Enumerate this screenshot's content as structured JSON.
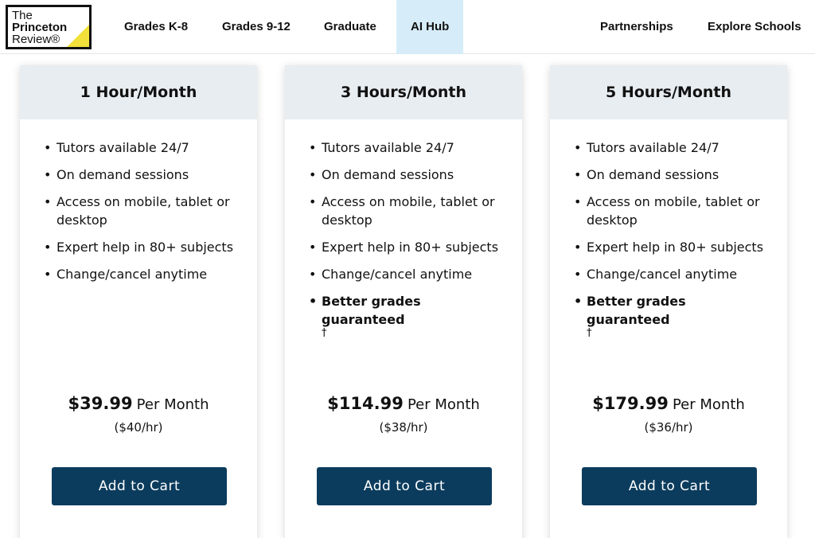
{
  "brand": {
    "line1": "The",
    "line2": "Princeton",
    "line3": "Review®"
  },
  "nav": {
    "left": [
      "Grades K-8",
      "Grades 9-12",
      "Graduate",
      "AI Hub"
    ],
    "right": [
      "Partnerships",
      "Explore Schools"
    ]
  },
  "plans": [
    {
      "title": "1 Hour/Month",
      "features": [
        "Tutors available 24/7",
        "On demand sessions",
        "Access on mobile, tablet or desktop",
        "Expert help in 80+ subjects",
        "Change/cancel anytime"
      ],
      "price": "$39.99",
      "per": "Per Month",
      "rate": "($40/hr)",
      "cta": "Add to Cart"
    },
    {
      "title": "3 Hours/Month",
      "features": [
        "Tutors available 24/7",
        "On demand sessions",
        "Access on mobile, tablet or desktop",
        "Expert help in 80+ subjects",
        "Change/cancel anytime"
      ],
      "guarantee": "Better grades guaranteed",
      "dagger": "†",
      "price": "$114.99",
      "per": "Per Month",
      "rate": "($38/hr)",
      "cta": "Add to Cart"
    },
    {
      "title": "5 Hours/Month",
      "features": [
        "Tutors available 24/7",
        "On demand sessions",
        "Access on mobile, tablet or desktop",
        "Expert help in 80+ subjects",
        "Change/cancel anytime"
      ],
      "guarantee": "Better grades guaranteed",
      "dagger": "†",
      "price": "$179.99",
      "per": "Per Month",
      "rate": "($36/hr)",
      "cta": "Add to Cart"
    }
  ],
  "colors": {
    "accent": "#0b3c5d",
    "card_header": "#e8edf1",
    "active_tab": "#d6ecf8",
    "logo_yellow": "#f2e13a"
  }
}
